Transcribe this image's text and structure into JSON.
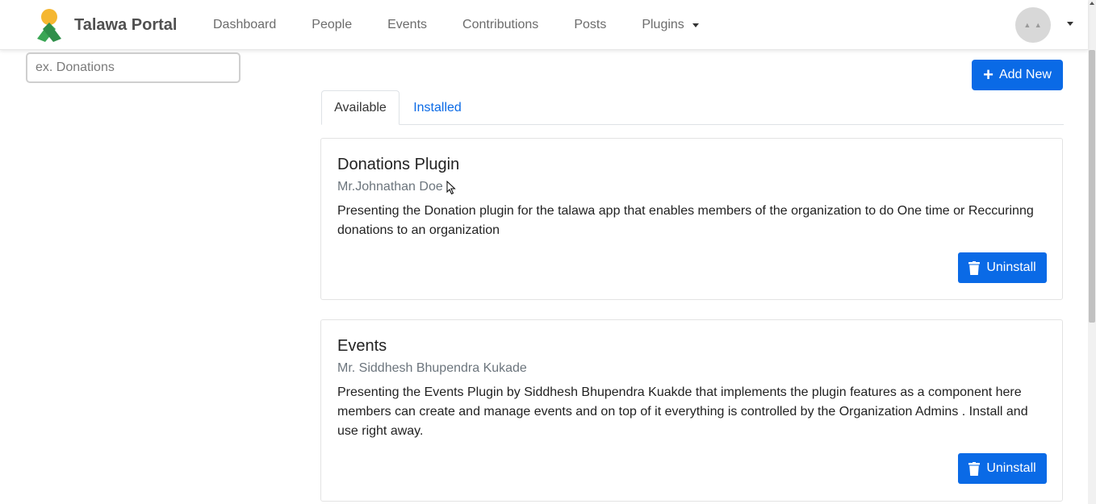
{
  "header": {
    "brand": "Talawa Portal",
    "nav": [
      "Dashboard",
      "People",
      "Events",
      "Contributions",
      "Posts"
    ],
    "plugins_menu": "Plugins"
  },
  "search": {
    "placeholder": "ex. Donations"
  },
  "toolbar": {
    "add_new_label": "Add New"
  },
  "tabs": {
    "available": "Available",
    "installed": "Installed",
    "active": "Available"
  },
  "plugins": [
    {
      "title": "Donations Plugin",
      "author": "Mr.Johnathan Doe",
      "description": "Presenting the Donation plugin for the talawa app that enables members of the organization to do One time or Reccurinng donations to an organization",
      "action": "Uninstall"
    },
    {
      "title": "Events",
      "author": "Mr. Siddhesh Bhupendra Kukade",
      "description": "Presenting the Events Plugin by Siddhesh Bhupendra Kuakde that implements the plugin features as a component here members can create and manage events and on top of it everything is controlled by the Organization Admins . Install and use right away.",
      "action": "Uninstall"
    }
  ],
  "colors": {
    "primary": "#0a6ae6",
    "logo_orange": "#f5b731",
    "logo_green": "#3aa655"
  }
}
